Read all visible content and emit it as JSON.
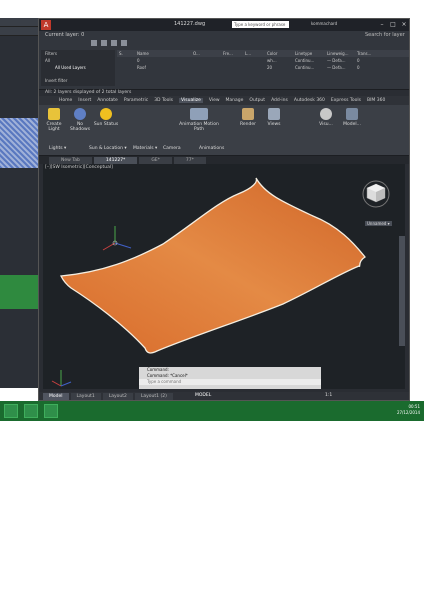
{
  "window": {
    "title": "141227.dwg",
    "search_placeholder": "Type a keyword or phrase",
    "user": "kommachard"
  },
  "layers_panel": {
    "current_layer": "Current layer: 0",
    "search_label": "Search for layer",
    "filters_label": "Filters",
    "filter_all": "All",
    "filter_all_used": "All Used Layers",
    "invert_filter": "Invert filter",
    "columns": [
      "S.",
      "Name",
      "O...",
      "Fre...",
      "L...",
      "Color",
      "Linetype",
      "Lineweig...",
      "Trans..."
    ],
    "rows": [
      [
        "",
        "0",
        "",
        "",
        "",
        "wh...",
        "Continu...",
        "— Defa...",
        "0"
      ],
      [
        "",
        "Roof",
        "",
        "",
        "",
        "20",
        "Continu...",
        "— Defa...",
        "0"
      ]
    ],
    "status": "All: 2 layers displayed of 2 total layers"
  },
  "ribbon": {
    "tabs": [
      "Home",
      "Insert",
      "Annotate",
      "Parametric",
      "3D Tools",
      "Visualize",
      "View",
      "Manage",
      "Output",
      "Add-ins",
      "Autodesk 360",
      "Express Tools",
      "BIM 360"
    ],
    "active_tab": "Visualize",
    "buttons": [
      "Create Light",
      "No Shadows",
      "Sun Status",
      "Animation Motion Path",
      "Render",
      "Views",
      "Visu...",
      "Model..."
    ],
    "groups": [
      "Lights ▾",
      "Sun & Location ▾",
      "Materials ▾",
      "Camera",
      "Animations"
    ]
  },
  "file_tabs": [
    "New Tab",
    "141227*",
    "GE*",
    "77*"
  ],
  "active_file_tab": "141227*",
  "viewport": {
    "label": "[–][SW Isometric][Conceptual]",
    "unnamed": "Unnamed ▾"
  },
  "command": {
    "history": [
      "Command:",
      "Command: *Cancel*"
    ],
    "input_placeholder": "Type a command"
  },
  "layout_tabs": [
    "Model",
    "Layout1",
    "Layout2",
    "Layout1 (2)"
  ],
  "active_layout": "Model",
  "status_model": "MODEL",
  "status_scale": "1:1",
  "taskbar": {
    "time": "00:51",
    "date": "27/12/2014"
  },
  "colors": {
    "roof": "#e07b39",
    "roof_edge": "#f3f0e8",
    "viewport_bg": "#1e2226",
    "taskbar": "#1a6b2e"
  }
}
